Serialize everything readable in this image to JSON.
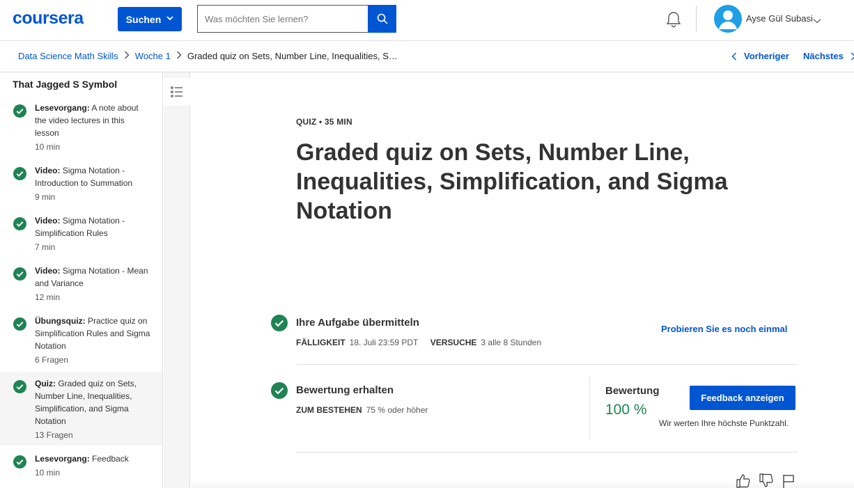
{
  "header": {
    "logo": "coursera",
    "search_button_label": "Suchen",
    "search_placeholder": "Was möchten Sie lernen?",
    "user_name": "Ayse Gül Subasi"
  },
  "breadcrumb": {
    "items": [
      "Data Science Math Skills",
      "Woche 1"
    ],
    "current": "Graded quiz on Sets, Number Line, Inequalities, S…",
    "prev_label": "Vorheriger",
    "next_label": "Nächstes"
  },
  "sidebar": {
    "title": "That Jagged S Symbol",
    "items": [
      {
        "type": "Lesevorgang:",
        "text": " A note about the video lectures in this lesson",
        "meta": "10 min"
      },
      {
        "type": "Video:",
        "text": " Sigma Notation - Introduction to Summation",
        "meta": "9 min"
      },
      {
        "type": "Video:",
        "text": " Sigma Notation - Simplification Rules",
        "meta": "7 min"
      },
      {
        "type": "Video:",
        "text": " Sigma Notation - Mean and Variance",
        "meta": "12 min"
      },
      {
        "type": "Übungsquiz:",
        "text": " Practice quiz on Simplification Rules and Sigma Notation",
        "meta": "6 Fragen"
      },
      {
        "type": "Quiz:",
        "text": " Graded quiz on Sets, Number Line, Inequalities, Simplification, and Sigma Notation",
        "meta": "13 Fragen"
      },
      {
        "type": "Lesevorgang:",
        "text": " Feedback",
        "meta": "10 min"
      }
    ]
  },
  "main": {
    "eyebrow": "QUIZ • 35 MIN",
    "title": "Graded quiz on Sets, Number Line, Inequalities, Simplification, and Sigma Notation",
    "submit": {
      "title": "Ihre Aufgabe übermitteln",
      "due_label": "FÄLLIGKEIT",
      "due_value": "18. Juli 23:59 PDT",
      "attempts_label": "VERSUCHE",
      "attempts_value": "3 alle 8 Stunden",
      "retry_label": "Probieren Sie es noch einmal"
    },
    "grade": {
      "title": "Bewertung erhalten",
      "pass_label": "ZUM BESTEHEN",
      "pass_value": "75 % oder höher",
      "grade_label": "Bewertung",
      "grade_value": "100 %",
      "feedback_button": "Feedback anzeigen",
      "note": "Wir werten Ihre höchste Punktzahl."
    }
  },
  "colors": {
    "brand": "#0056d2",
    "success": "#1f8354",
    "avatar": "#1f9fe5"
  },
  "icons": [
    "search-icon",
    "bell-icon",
    "avatar-icon",
    "chevron-down-icon",
    "chevron-left-icon",
    "chevron-right-icon",
    "check-circle-icon",
    "list-icon",
    "thumbs-up-icon",
    "thumbs-down-icon",
    "flag-icon"
  ]
}
